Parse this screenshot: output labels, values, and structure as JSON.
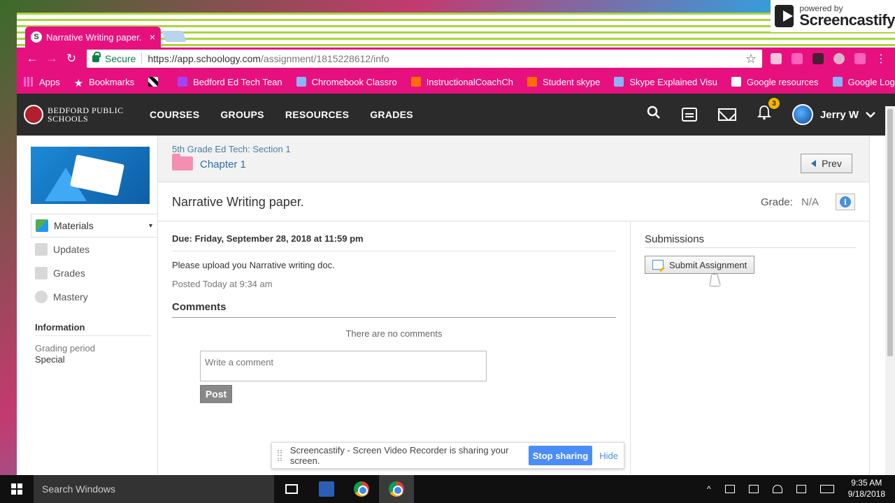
{
  "badge": {
    "powered": "powered by",
    "brand": "Screencastify"
  },
  "browser": {
    "tab": {
      "favicon": "S",
      "title": "Narrative Writing paper.",
      "close": "×"
    },
    "toolbar": {
      "back": "←",
      "forward": "→",
      "reload": "↻",
      "secure": "Secure",
      "url_host": "https://app.schoology.com",
      "url_path": "/assignment/1815228612/info",
      "star": "☆",
      "menu": "⋮"
    },
    "bookmarks": [
      {
        "label": "Apps",
        "icon": "apps-icon"
      },
      {
        "label": "Bookmarks",
        "icon": "star-icon"
      },
      {
        "label": "",
        "icon": "checker-icon"
      },
      {
        "label": "Bedford Ed Tech Tean",
        "icon": "w-icon"
      },
      {
        "label": "Chromebook Classro",
        "icon": "blue-doc-icon"
      },
      {
        "label": "InstructionalCoachCh",
        "icon": "pinwheel-icon"
      },
      {
        "label": "Student skype",
        "icon": "blogger-icon"
      },
      {
        "label": "Skype Explained Visu",
        "icon": "blue-doc-icon"
      },
      {
        "label": "Google resources",
        "icon": "page-icon"
      },
      {
        "label": "Google Logo",
        "icon": "google-icon"
      }
    ],
    "bookmarks_more": "»"
  },
  "header": {
    "brand_line1": "BEDFORD PUBLIC",
    "brand_line2": "SCHOOLS",
    "nav": [
      "COURSES",
      "GROUPS",
      "RESOURCES",
      "GRADES"
    ],
    "notifications_count": "3",
    "user_name": "Jerry W",
    "search_glyph": "⚲",
    "chevron": "⌄"
  },
  "sidebar": {
    "items": [
      {
        "label": "Materials",
        "active": true
      },
      {
        "label": "Updates"
      },
      {
        "label": "Grades"
      },
      {
        "label": "Mastery"
      }
    ],
    "caret": "▾",
    "information_title": "Information",
    "grading_period_label": "Grading period",
    "grading_period_value": "Special"
  },
  "breadcrumb": {
    "course": "5th Grade Ed Tech: Section 1",
    "folder": "Chapter 1",
    "prev": "Prev"
  },
  "assignment": {
    "title": "Narrative Writing paper.",
    "grade_label": "Grade:",
    "grade_value": "N/A",
    "info_glyph": "i",
    "due": "Due: Friday, September 28, 2018 at 11:59 pm",
    "description": "Please upload you Narrative writing doc.",
    "posted": "Posted Today at 9:34 am",
    "comments_title": "Comments",
    "no_comments": "There are no comments",
    "comment_placeholder": "Write a comment",
    "post_button": "Post"
  },
  "submissions": {
    "title": "Submissions",
    "submit_button": "Submit Assignment"
  },
  "share_bar": {
    "message": "Screencastify - Screen Video Recorder is sharing your screen.",
    "stop": "Stop sharing",
    "hide": "Hide"
  },
  "taskbar": {
    "search": "Search Windows",
    "time": "9:35 AM",
    "date": "9/18/2018",
    "tray_caret": "^"
  }
}
